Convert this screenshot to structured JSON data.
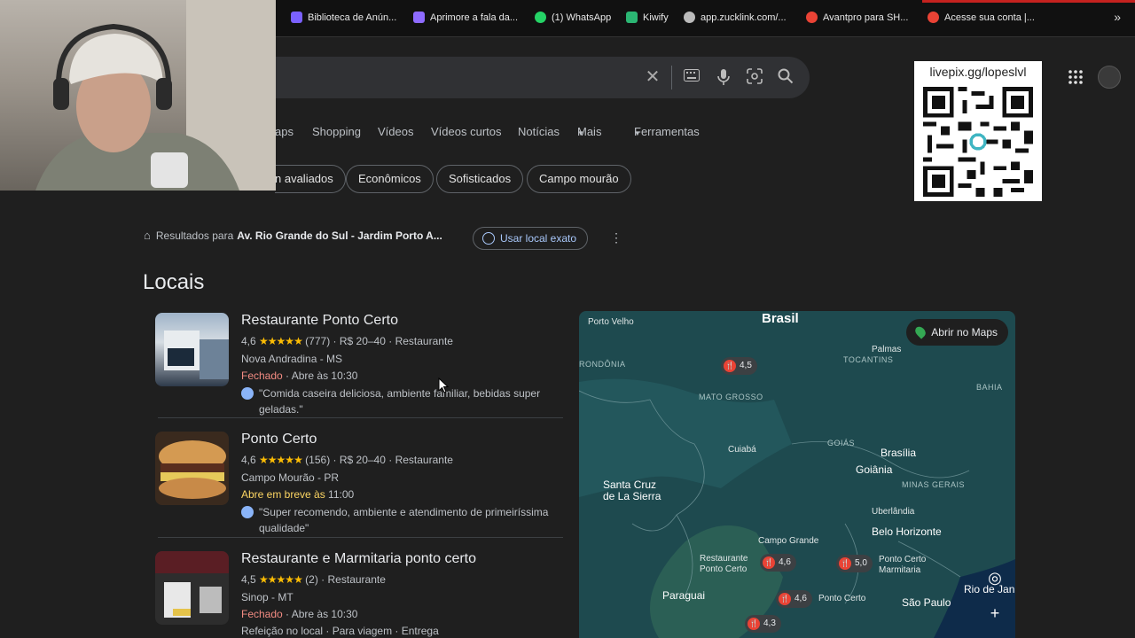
{
  "bookmarks": [
    {
      "label": "Biblioteca de Anún...",
      "color": "#7b61ff"
    },
    {
      "label": "Aprimore a fala da...",
      "color": "#8e6bff"
    },
    {
      "label": "(1) WhatsApp",
      "color": "#25d366"
    },
    {
      "label": "Kiwify",
      "color": "#2bb673"
    },
    {
      "label": "app.zucklink.com/...",
      "color": "#bbbbbb"
    },
    {
      "label": "Avantpro para SH...",
      "color": "#ea4335"
    },
    {
      "label": "Acesse sua conta |...",
      "color": "#ea4335"
    }
  ],
  "bookmarks_more": "»",
  "search": {
    "clear_icon": "close-icon",
    "keyboard_icon": "keyboard-icon",
    "mic_icon": "mic-icon",
    "lens_icon": "lens-icon",
    "search_icon": "search-icon"
  },
  "tabs": [
    "aps",
    "Shopping",
    "Vídeos",
    "Vídeos curtos",
    "Notícias",
    "Mais",
    "Ferramentas"
  ],
  "chips": [
    "n avaliados",
    "Econômicos",
    "Sofisticados",
    "Campo mourão"
  ],
  "qr": {
    "url_text": "livepix.gg/lopeslvl"
  },
  "location": {
    "prefix": "Resultados para",
    "address": "Av. Rio Grande do Sul - Jardim Porto A...",
    "exact_button": "Usar local exato"
  },
  "section_title": "Locais",
  "places": [
    {
      "name": "Restaurante Ponto Certo",
      "rating": "4,6",
      "stars": "★★★★★",
      "reviews": "(777)",
      "price": "R$ 20–40",
      "category": "Restaurante",
      "city": "Nova Andradina - MS",
      "status": "Fechado",
      "status_type": "closed",
      "hours": "· Abre às 10:30",
      "review": "\"Comida caseira deliciosa, ambiente familiar, bebidas super geladas.\""
    },
    {
      "name": "Ponto Certo",
      "rating": "4,6",
      "stars": "★★★★★",
      "reviews": "(156)",
      "price": "R$ 20–40",
      "category": "Restaurante",
      "city": "Campo Mourão - PR",
      "status": "Abre em breve às",
      "status_type": "soon",
      "hours": " 11:00",
      "review": "\"Super recomendo, ambiente e atendimento de primeiríssima qualidade\""
    },
    {
      "name": "Restaurante e Marmitaria ponto certo",
      "rating": "4,5",
      "stars": "★★★★★",
      "reviews": "(2)",
      "price": "",
      "category": "Restaurante",
      "city": "Sinop - MT",
      "status": "Fechado",
      "status_type": "closed",
      "hours": "· Abre às 10:30",
      "extra": "Refeição no local · Para viagem · Entrega"
    }
  ],
  "map": {
    "open_button": "Abrir no Maps",
    "labels": {
      "brasil": "Brasil",
      "porto_velho": "Porto Velho",
      "rondonia": "RONDÔNIA",
      "palmas": "Palmas",
      "tocantins": "TOCANTINS",
      "bahia": "BAHIA",
      "mato_grosso": "MATO GROSSO",
      "cuiaba": "Cuiabá",
      "goias": "GOIÁS",
      "brasilia": "Brasília",
      "goiania": "Goiânia",
      "minas": "MINAS GERAIS",
      "santa_cruz": "Santa Cruz\nde La Sierra",
      "uberlandia": "Uberlândia",
      "bh": "Belo Horizonte",
      "campo_grande": "Campo Grande",
      "paraguai": "Paraguai",
      "sao_paulo": "São Paulo",
      "rio": "Rio de Jan",
      "rest_ponto_certo": "Restaurante\nPonto Certo",
      "ponto_certo_marm": "Ponto Certo\nMarmitaria",
      "ponto_certo": "Ponto Certo"
    },
    "pins": [
      "4,5",
      "4,6",
      "5,0",
      "4,6",
      "4,3"
    ]
  }
}
